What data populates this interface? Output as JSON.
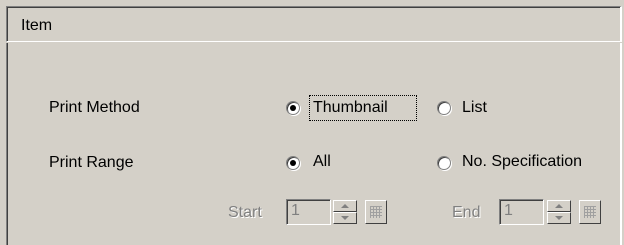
{
  "header": {
    "label": "Item"
  },
  "print_method": {
    "label": "Print Method",
    "options": [
      {
        "label": "Thumbnail",
        "selected": true
      },
      {
        "label": "List",
        "selected": false
      }
    ]
  },
  "print_range": {
    "label": "Print Range",
    "options": [
      {
        "label": "All",
        "selected": true
      },
      {
        "label": "No. Specification",
        "selected": false
      }
    ]
  },
  "range_fields": {
    "start": {
      "label": "Start",
      "value": "1",
      "enabled": false
    },
    "end": {
      "label": "End",
      "value": "1",
      "enabled": false
    }
  },
  "colors": {
    "background": "#d4d0c8",
    "disabled_text": "#808080"
  },
  "icons": {
    "spin": "spin-arrows-icon",
    "grid": "grid-icon"
  }
}
